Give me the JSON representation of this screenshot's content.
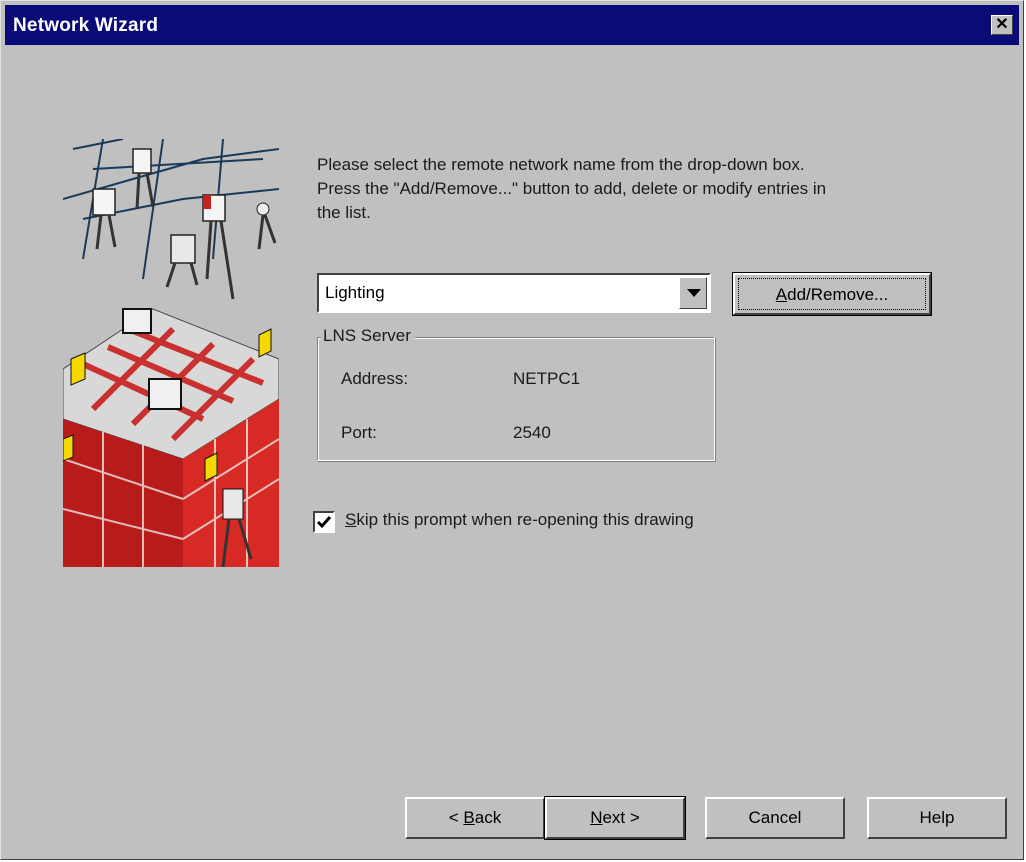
{
  "window": {
    "title": "Network Wizard",
    "close_glyph": "✕",
    "title_bar_color": "#0a0a78"
  },
  "instructions": {
    "line1": "Please select the remote network name from the drop-down box.",
    "line2": "Press the \"Add/Remove...\" button to add, delete or modify entries in",
    "line3": "the list."
  },
  "network_select": {
    "value": "Lighting"
  },
  "add_remove_button": {
    "label_u": "A",
    "label_rest": "dd/Remove..."
  },
  "lns_server": {
    "legend": "LNS Server",
    "address_label": "Address:",
    "address_value": "NETPC1",
    "port_label": "Port:",
    "port_value": "2540"
  },
  "skip_prompt": {
    "checked": true,
    "label_u": "S",
    "label_rest": "kip this prompt when re-opening this drawing"
  },
  "buttons": {
    "back_prefix": "< ",
    "back_u": "B",
    "back_rest": "ack",
    "next_u": "N",
    "next_rest": "ext >",
    "cancel": "Cancel",
    "help": "Help"
  }
}
